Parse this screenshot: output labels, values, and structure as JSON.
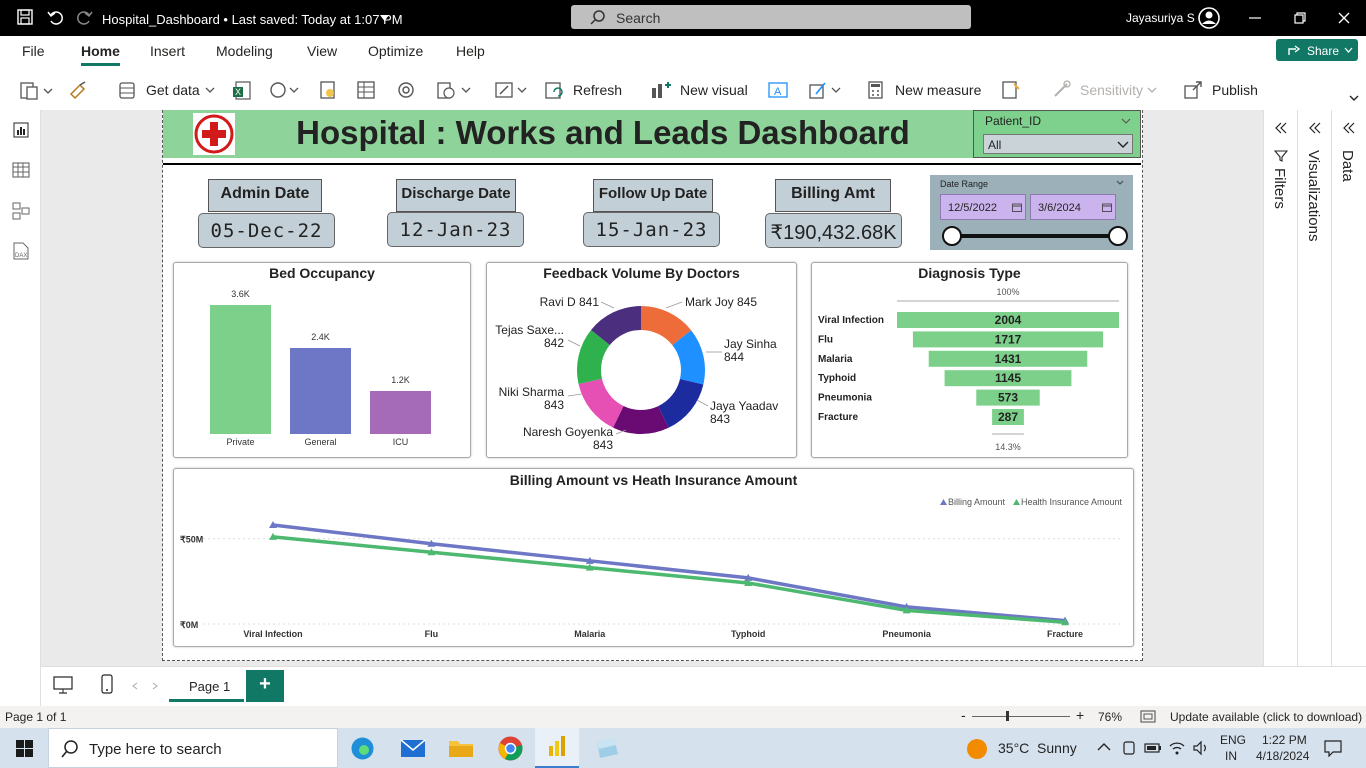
{
  "window": {
    "doc_title": "Hospital_Dashboard • Last saved: Today at 1:07 PM",
    "search_placeholder": "Search",
    "user_name": "Jayasuriya S"
  },
  "ribbon": {
    "menu": [
      "File",
      "Home",
      "Insert",
      "Modeling",
      "View",
      "Optimize",
      "Help"
    ],
    "active_menu": "Home",
    "share_label": "Share",
    "tools": {
      "get_data": "Get data",
      "refresh": "Refresh",
      "new_visual": "New visual",
      "new_measure": "New measure",
      "sensitivity": "Sensitivity",
      "publish": "Publish"
    }
  },
  "dashboard": {
    "title": "Hospital : Works and Leads Dashboard",
    "patient_slicer": {
      "label": "Patient_ID",
      "value": "All"
    },
    "kpis": [
      {
        "label": "Admin Date",
        "value": "05-Dec-22"
      },
      {
        "label": "Discharge Date",
        "value": "12-Jan-23"
      },
      {
        "label": "Follow Up Date",
        "value": "15-Jan-23"
      },
      {
        "label": "Billing Amt",
        "value": "₹190,432.68K"
      }
    ],
    "date_range": {
      "label": "Date Range",
      "start": "12/5/2022",
      "end": "3/6/2024"
    }
  },
  "chart_data": [
    {
      "type": "bar",
      "title": "Bed Occupancy",
      "categories": [
        "Private",
        "General",
        "ICU"
      ],
      "values": [
        3600,
        2400,
        1200
      ],
      "labels": [
        "3.6K",
        "2.4K",
        "1.2K"
      ],
      "colors": [
        "#7dd08a",
        "#6e77c5",
        "#a56ab8"
      ]
    },
    {
      "type": "pie",
      "title": "Feedback Volume By Doctors",
      "series": [
        {
          "name": "Mark Joy",
          "value": 845,
          "color": "#ed6c3a"
        },
        {
          "name": "Jay Sinha",
          "value": 844,
          "color": "#1e90ff"
        },
        {
          "name": "Jaya Yaadav",
          "value": 843,
          "color": "#1c2c9e"
        },
        {
          "name": "Naresh Goyenka",
          "value": 843,
          "color": "#6a0a73"
        },
        {
          "name": "Niki Sharma",
          "value": 843,
          "color": "#e64fb3"
        },
        {
          "name": "Tejas Saxe...",
          "value": 842,
          "color": "#2fb24d"
        },
        {
          "name": "Ravi D",
          "value": 841,
          "color": "#4b2e7e"
        }
      ]
    },
    {
      "type": "bar",
      "title": "Diagnosis Type",
      "categories": [
        "Viral Infection",
        "Flu",
        "Malaria",
        "Typhoid",
        "Pneumonia",
        "Fracture"
      ],
      "values": [
        2004,
        1717,
        1431,
        1145,
        573,
        287
      ],
      "top_label": "100%",
      "bottom_label": "14.3%",
      "color": "#7dd08a"
    },
    {
      "type": "line",
      "title": "Billing Amount vs Heath Insurance Amount",
      "categories": [
        "Viral Infection",
        "Flu",
        "Malaria",
        "Typhoid",
        "Pneumonia",
        "Fracture"
      ],
      "y_ticks": [
        "₹50M",
        "₹0M"
      ],
      "ylim": [
        0,
        65
      ],
      "series": [
        {
          "name": "Billing Amount",
          "values": [
            58,
            47,
            37,
            27,
            10,
            2
          ],
          "color": "#6e77c5"
        },
        {
          "name": "Health Insurance Amount",
          "values": [
            51,
            42,
            33,
            24,
            8,
            1
          ],
          "color": "#4db870"
        }
      ]
    }
  ],
  "panes": {
    "filters": "Filters",
    "visualizations": "Visualizations",
    "data": "Data"
  },
  "pages": {
    "tab": "Page 1",
    "add": "+"
  },
  "status": {
    "page": "Page 1 of 1",
    "zoom": "76%",
    "update": "Update available (click to download)"
  },
  "taskbar": {
    "search_placeholder": "Type here to search",
    "weather": "35°C  Sunny",
    "lang1": "ENG",
    "lang2": "IN",
    "time": "1:22 PM",
    "date": "4/18/2024"
  }
}
